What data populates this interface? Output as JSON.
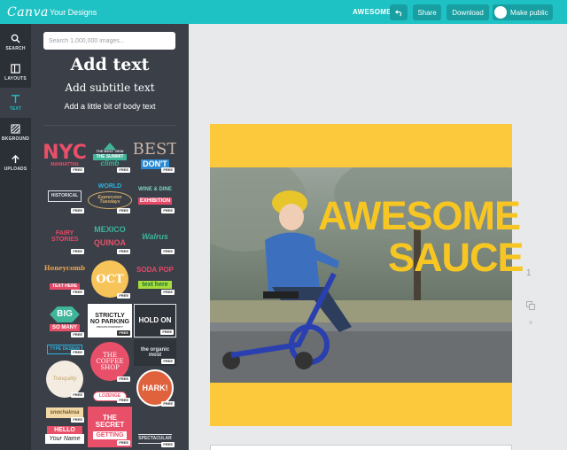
{
  "topbar": {
    "logo": "Canva",
    "nav_link": "Your Designs",
    "document_title": "AWESOME",
    "undo_icon": "undo-icon",
    "share_label": "Share",
    "download_label": "Download",
    "make_public_label": "Make public",
    "accent": "#1fc2c4"
  },
  "rail": {
    "items": [
      {
        "label": "SEARCH",
        "icon": "search-icon"
      },
      {
        "label": "LAYOUTS",
        "icon": "layouts-icon"
      },
      {
        "label": "TEXT",
        "icon": "text-icon"
      },
      {
        "label": "BKGROUND",
        "icon": "background-icon"
      },
      {
        "label": "UPLOADS",
        "icon": "upload-icon"
      }
    ],
    "active": "TEXT"
  },
  "panel": {
    "search_placeholder": "Search 1,000,000 images...",
    "add_title": "Add text",
    "add_subtitle": "Add subtitle text",
    "add_body": "Add a little bit of body text",
    "free_badge": "FREE",
    "tiles": {
      "nyc": "NYC",
      "manhattan": "MANHATTAN",
      "best_view": "THE BEST VIEW",
      "summit": "THE SUMMIT",
      "climb": "climb",
      "best": "BEST",
      "dont": "DON'T",
      "world": "WORLD",
      "historical": "HISTORICAL",
      "expression": "Expression Tuesdays",
      "wine": "WINE & DINE",
      "fairy": "FAIRY STORIES",
      "mexico": "MEXICO",
      "exhibition": "EXHIBITION",
      "quinoa": "QUINOA",
      "walrus": "Walrus",
      "honeycomb": "Honeycomb",
      "oct": "OCT",
      "soda": "SODA POP",
      "text_here": "TEXT HERE",
      "text_here2": "text here",
      "big": "BIG",
      "so_many": "SO MANY",
      "strictly": "STRICTLY",
      "no_parking": "NO PARKING",
      "private": "PRIVATE PROPERTY",
      "hold_on": "HOLD ON",
      "type_design": "TYPE DESIGN",
      "the_coffee": "THE COFFEE SHOP",
      "organic": "the organic most",
      "tranquility": "Tranquility",
      "lozenge": "LOZENGE",
      "hark": "HARK!",
      "snochalosa": "snochalosa",
      "secret": "THE SECRET",
      "getting": "GETTING",
      "hello": "HELLO",
      "your_name": "Your Name",
      "spectacular": "SPECTACULAR"
    }
  },
  "canvas": {
    "headline_1": "AWESOME",
    "headline_2": "SAUCE",
    "page_number": "1",
    "background_color": "#fbc93b",
    "headline_color": "#f7c623"
  }
}
